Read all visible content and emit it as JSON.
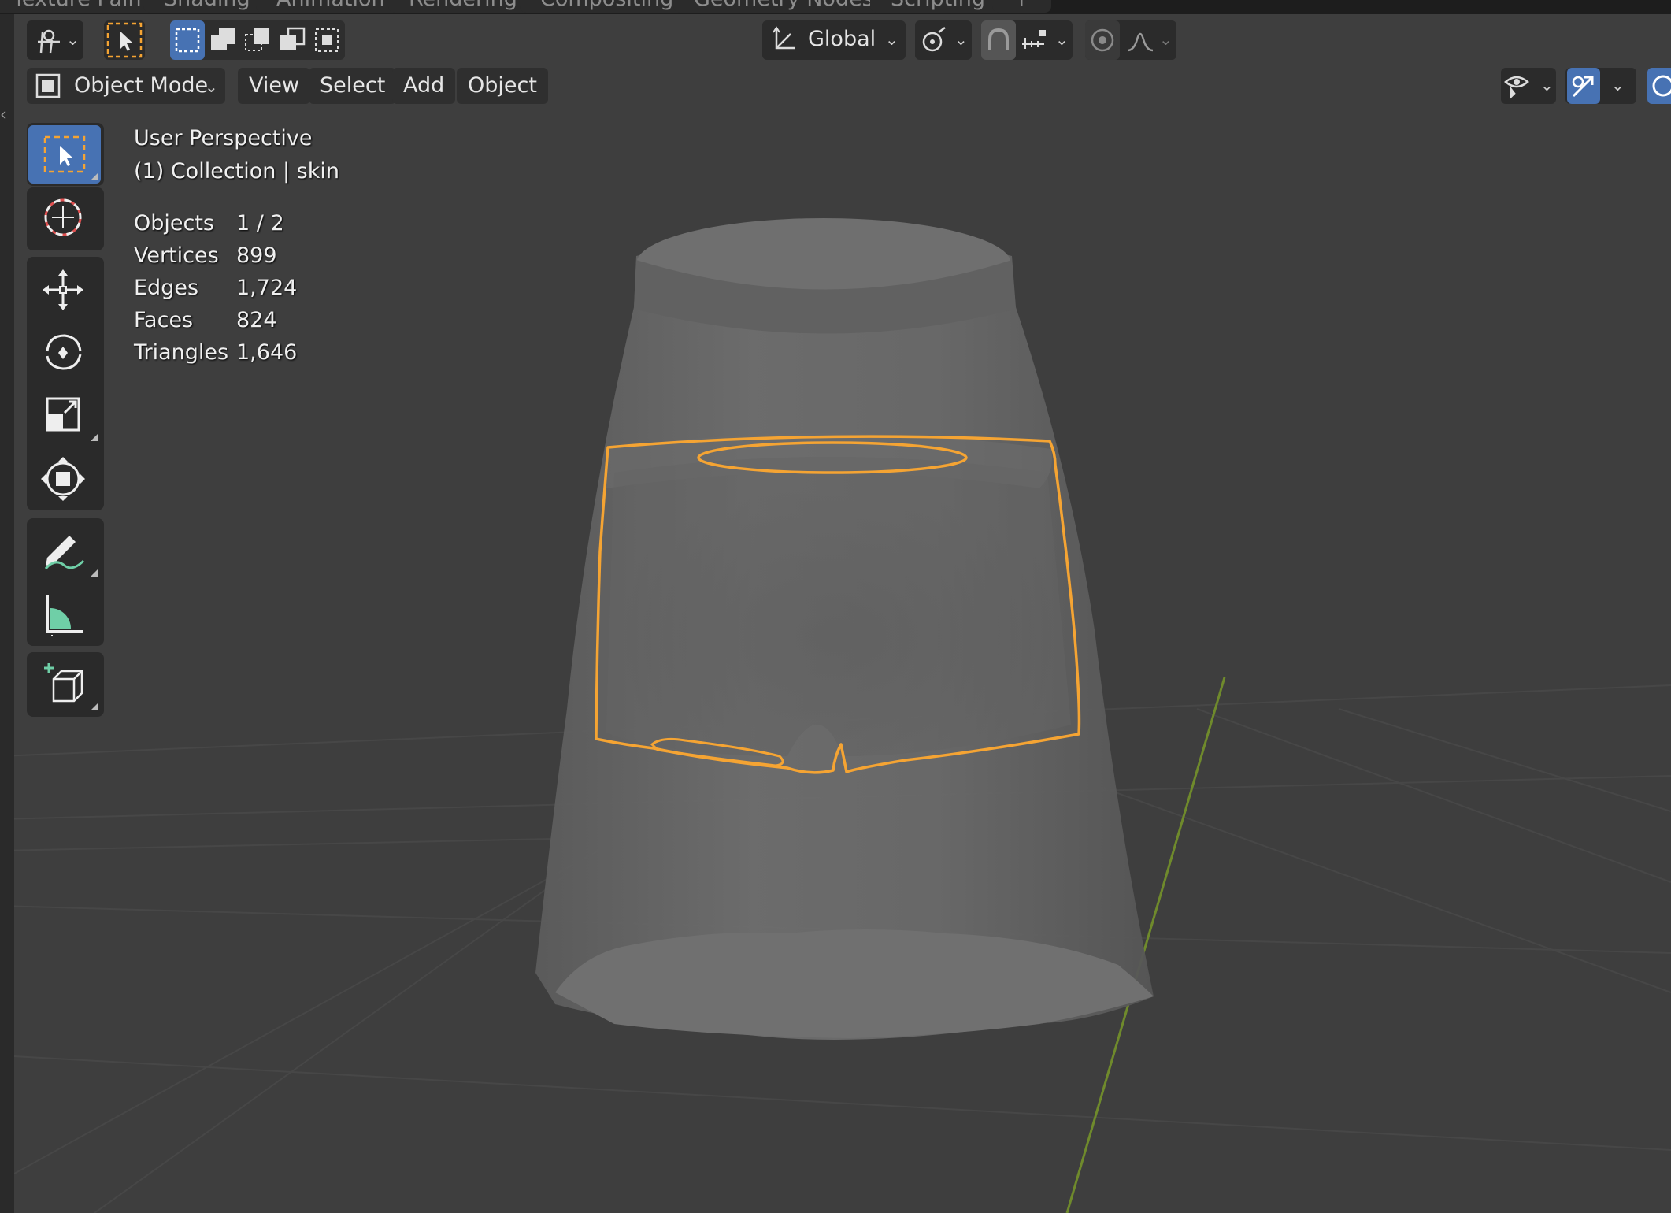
{
  "workspace_tabs": [
    "Texture Paint",
    "Shading",
    "Animation",
    "Rendering",
    "Compositing",
    "Geometry Nodes",
    "Scripting",
    "+"
  ],
  "header": {
    "transform_orientation": "Global"
  },
  "menu": {
    "mode": "Object Mode",
    "view": "View",
    "select": "Select",
    "add": "Add",
    "object": "Object"
  },
  "overlay": {
    "view_name": "User Perspective",
    "collection": "(1) Collection | skin",
    "stats": [
      {
        "label": "Objects",
        "value": "1 / 2"
      },
      {
        "label": "Vertices",
        "value": "899"
      },
      {
        "label": "Edges",
        "value": "1,724"
      },
      {
        "label": "Faces",
        "value": "824"
      },
      {
        "label": "Triangles",
        "value": "1,646"
      }
    ]
  },
  "colors": {
    "selection_outline": "#f5a433",
    "active_tool": "#4772b3",
    "y_axis": "#6f8a2c"
  }
}
